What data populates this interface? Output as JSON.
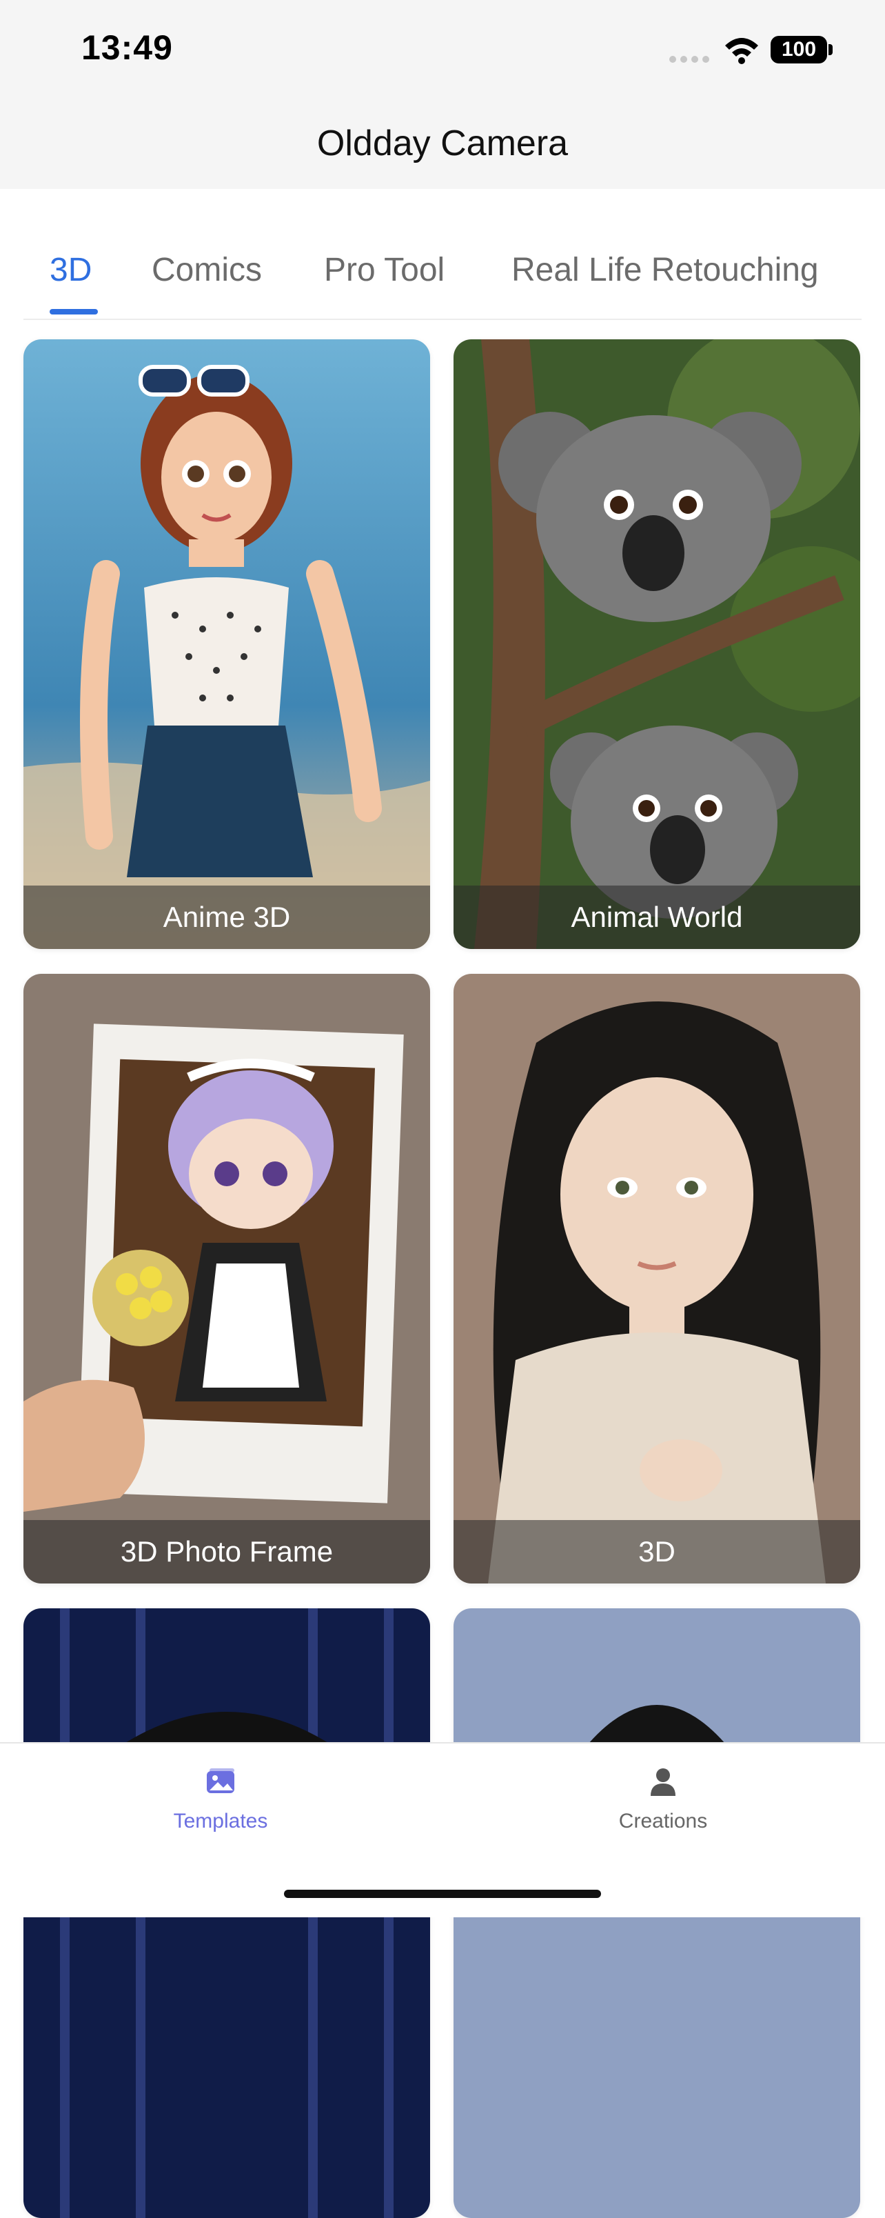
{
  "status_bar": {
    "time": "13:49",
    "battery": "100"
  },
  "header": {
    "title": "Oldday Camera"
  },
  "tabs": [
    {
      "label": "3D",
      "active": true
    },
    {
      "label": "Comics",
      "active": false
    },
    {
      "label": "Pro Tool",
      "active": false
    },
    {
      "label": "Real Life Retouching",
      "active": false
    }
  ],
  "cards": [
    {
      "label": "Anime 3D"
    },
    {
      "label": "Animal World"
    },
    {
      "label": "3D Photo Frame"
    },
    {
      "label": "3D"
    },
    {
      "label": ""
    },
    {
      "label": ""
    }
  ],
  "bottom_nav": [
    {
      "label": "Templates",
      "icon": "templates-icon",
      "active": true
    },
    {
      "label": "Creations",
      "icon": "person-icon",
      "active": false
    }
  ],
  "colors": {
    "accent": "#2f6fe0",
    "nav_active": "#6b6fe0",
    "nav_inactive": "#666666"
  }
}
